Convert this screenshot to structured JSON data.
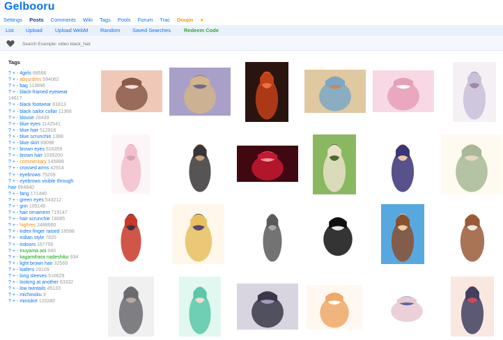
{
  "site": {
    "logo": "Gelbooru"
  },
  "topnav": [
    {
      "label": "Settings"
    },
    {
      "label": "Posts"
    },
    {
      "label": "Comments"
    },
    {
      "label": "Wiki"
    },
    {
      "label": "Tags"
    },
    {
      "label": "Pools"
    },
    {
      "label": "Forum"
    },
    {
      "label": "Trac"
    },
    {
      "label": "Doujin"
    }
  ],
  "subnav": [
    {
      "label": "List"
    },
    {
      "label": "Upload"
    },
    {
      "label": "Upload WebM"
    },
    {
      "label": "Random"
    },
    {
      "label": "Saved Searches"
    },
    {
      "label": "Redeem Code"
    }
  ],
  "search": {
    "placeholder": "Search Example: video black_hair"
  },
  "sidebar": {
    "title": "Tags",
    "tags": [
      {
        "name": "4girls",
        "count": "68566",
        "type": "general"
      },
      {
        "name": "absurdres",
        "count": "594062",
        "type": "meta"
      },
      {
        "name": "bag",
        "count": "113896",
        "type": "general"
      },
      {
        "name": "black-framed eyewear",
        "count": "14617",
        "type": "general"
      },
      {
        "name": "black footwear",
        "count": "81813",
        "type": "general"
      },
      {
        "name": "black sailor collar",
        "count": "11368",
        "type": "general"
      },
      {
        "name": "blouse",
        "count": "28439",
        "type": "general"
      },
      {
        "name": "blue eyes",
        "count": "1142541",
        "type": "general"
      },
      {
        "name": "blue hair",
        "count": "512816",
        "type": "general"
      },
      {
        "name": "blue scrunchie",
        "count": "1388",
        "type": "general"
      },
      {
        "name": "blue skirt",
        "count": "69098",
        "type": "general"
      },
      {
        "name": "brown eyes",
        "count": "616359",
        "type": "general"
      },
      {
        "name": "brown hair",
        "count": "1035200",
        "type": "general"
      },
      {
        "name": "commentary",
        "count": "145886",
        "type": "meta"
      },
      {
        "name": "crossed arms",
        "count": "42914",
        "type": "general"
      },
      {
        "name": "eyebrows",
        "count": "75209",
        "type": "general"
      },
      {
        "name": "eyebrows visible through hair",
        "count": "664840",
        "type": "general"
      },
      {
        "name": "fang",
        "count": "171440",
        "type": "general"
      },
      {
        "name": "green eyes",
        "count": "543212",
        "type": "general"
      },
      {
        "name": "gnn",
        "count": "105146",
        "type": "general"
      },
      {
        "name": "hair ornament",
        "count": "719147",
        "type": "general"
      },
      {
        "name": "hair scrunchie",
        "count": "19085",
        "type": "general"
      },
      {
        "name": "highres",
        "count": "2488660",
        "type": "meta"
      },
      {
        "name": "index finger raised",
        "count": "18598",
        "type": "general"
      },
      {
        "name": "indian style",
        "count": "7820",
        "type": "general"
      },
      {
        "name": "indoors",
        "count": "167756",
        "type": "general"
      },
      {
        "name": "Inuyama aoi",
        "count": "940",
        "type": "character"
      },
      {
        "name": "kagamihara nadeshiko",
        "count": "934",
        "type": "character"
      },
      {
        "name": "light brown hair",
        "count": "32569",
        "type": "general"
      },
      {
        "name": "loafers",
        "count": "29109",
        "type": "general"
      },
      {
        "name": "long sleeves",
        "count": "516629",
        "type": "general"
      },
      {
        "name": "looking at another",
        "count": "63332",
        "type": "general"
      },
      {
        "name": "low twintails",
        "count": "45133",
        "type": "general"
      },
      {
        "name": "michinoku",
        "count": "3",
        "type": "general"
      },
      {
        "name": "miniskirt",
        "count": "120280",
        "type": "general"
      }
    ]
  },
  "thumbnails": [
    {
      "label": "thumb-1",
      "colors": [
        "#f0c8b8",
        "#8a5a4a",
        "#f6e4dc"
      ]
    },
    {
      "label": "thumb-2",
      "colors": [
        "#a8a0c8",
        "#d4b48a",
        "#6e6a8c"
      ]
    },
    {
      "label": "thumb-3",
      "colors": [
        "#2a1410",
        "#c24018",
        "#f07040"
      ]
    },
    {
      "label": "thumb-4",
      "colors": [
        "#e0c8a0",
        "#7aa8c8",
        "#c88858"
      ]
    },
    {
      "label": "thumb-5",
      "colors": [
        "#f8d8e4",
        "#e6a0b8",
        "#ffffff"
      ]
    },
    {
      "label": "thumb-6",
      "colors": [
        "#f4f0f4",
        "#c8c0d8",
        "#a088a8"
      ]
    },
    {
      "label": "thumb-7",
      "colors": [
        "#fdf6f8",
        "#f2c0cc",
        "#d8a4b0"
      ]
    },
    {
      "label": "thumb-8",
      "colors": [
        "#ffffff",
        "#3a3638",
        "#c8a078"
      ]
    },
    {
      "label": "thumb-9",
      "colors": [
        "#400810",
        "#c81830",
        "#f0a0a8"
      ]
    },
    {
      "label": "thumb-10",
      "colors": [
        "#8ab860",
        "#e8e0c8",
        "#4a6a30"
      ]
    },
    {
      "label": "thumb-11",
      "colors": [
        "#ffffff",
        "#3a3478",
        "#f0c8a0"
      ]
    },
    {
      "label": "thumb-12",
      "colors": [
        "#fffaf0",
        "#a8b898",
        "#e8d8c0"
      ]
    },
    {
      "label": "thumb-13",
      "colors": [
        "#ffffff",
        "#c83828",
        "#3a3048"
      ]
    },
    {
      "label": "thumb-14",
      "colors": [
        "#fff8ea",
        "#e8c060",
        "#5a4878"
      ]
    },
    {
      "label": "thumb-15",
      "colors": [
        "#ffffff",
        "#5a5a5a",
        "#a8a8a8"
      ]
    },
    {
      "label": "thumb-16",
      "colors": [
        "#ffffff",
        "#101010",
        "#e8e8e8"
      ]
    },
    {
      "label": "thumb-17",
      "colors": [
        "#58a8e0",
        "#8a5030",
        "#e8d0a0"
      ]
    },
    {
      "label": "thumb-18",
      "colors": [
        "#ffffff",
        "#9a5a38",
        "#f0e8e0"
      ]
    },
    {
      "label": "thumb-19",
      "colors": [
        "#f0f0f0",
        "#6a6a70",
        "#b8a8a0"
      ]
    },
    {
      "label": "thumb-20",
      "colors": [
        "#e0f8f0",
        "#58c8a8",
        "#f8d8d0"
      ]
    },
    {
      "label": "thumb-21",
      "colors": [
        "#d8d4e0",
        "#3a3848",
        "#a89ac0"
      ]
    },
    {
      "label": "thumb-22",
      "colors": [
        "#fff8f0",
        "#f0a868",
        "#ffffff"
      ]
    },
    {
      "label": "thumb-23",
      "colors": [
        "#ffffff",
        "#e8c8d0",
        "#5868a8"
      ]
    },
    {
      "label": "thumb-24",
      "colors": [
        "#f8e8e0",
        "#404060",
        "#d04858"
      ]
    }
  ]
}
